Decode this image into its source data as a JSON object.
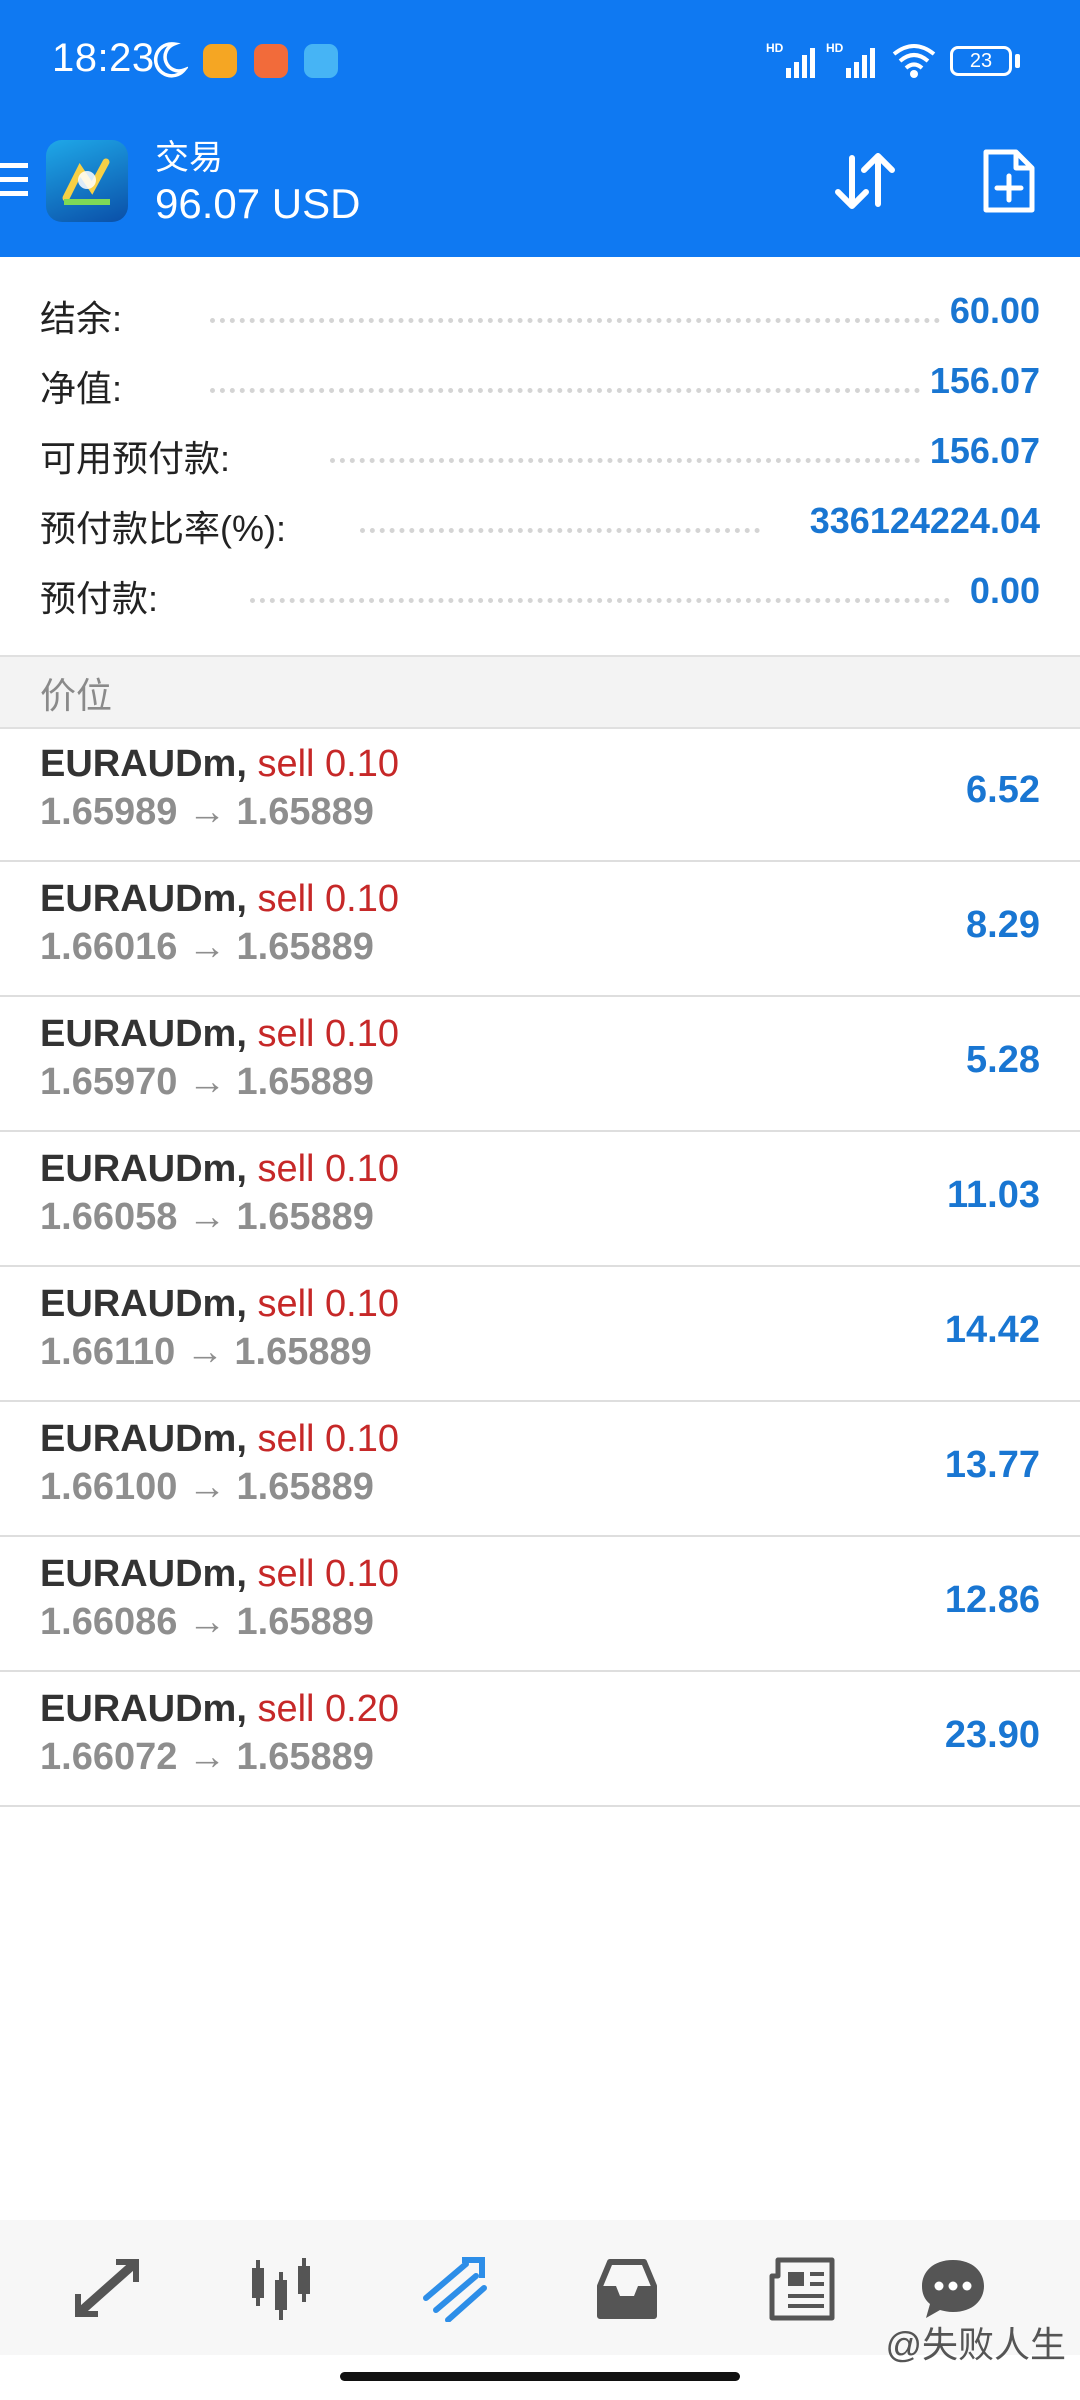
{
  "status_bar": {
    "time": "18:23",
    "battery": "23"
  },
  "header": {
    "title": "交易",
    "balance": "96.07 USD",
    "accent_color": "#0f79f2"
  },
  "summary": [
    {
      "label": "结余:",
      "value": "60.00"
    },
    {
      "label": "净值:",
      "value": "156.07"
    },
    {
      "label": "可用预付款:",
      "value": "156.07"
    },
    {
      "label": "预付款比率(%):",
      "value": "336124224.04"
    },
    {
      "label": "预付款:",
      "value": "0.00"
    }
  ],
  "section": {
    "title": "价位"
  },
  "positions": [
    {
      "symbol": "EURAUDm,",
      "side": "sell 0.10",
      "open": "1.65989",
      "arrow": "→",
      "current": "1.65889",
      "profit": "6.52"
    },
    {
      "symbol": "EURAUDm,",
      "side": "sell 0.10",
      "open": "1.66016",
      "arrow": "→",
      "current": "1.65889",
      "profit": "8.29"
    },
    {
      "symbol": "EURAUDm,",
      "side": "sell 0.10",
      "open": "1.65970",
      "arrow": "→",
      "current": "1.65889",
      "profit": "5.28"
    },
    {
      "symbol": "EURAUDm,",
      "side": "sell 0.10",
      "open": "1.66058",
      "arrow": "→",
      "current": "1.65889",
      "profit": "11.03"
    },
    {
      "symbol": "EURAUDm,",
      "side": "sell 0.10",
      "open": "1.66110",
      "arrow": "→",
      "current": "1.65889",
      "profit": "14.42"
    },
    {
      "symbol": "EURAUDm,",
      "side": "sell 0.10",
      "open": "1.66100",
      "arrow": "→",
      "current": "1.65889",
      "profit": "13.77"
    },
    {
      "symbol": "EURAUDm,",
      "side": "sell 0.10",
      "open": "1.66086",
      "arrow": "→",
      "current": "1.65889",
      "profit": "12.86"
    },
    {
      "symbol": "EURAUDm,",
      "side": "sell 0.20",
      "open": "1.66072",
      "arrow": "→",
      "current": "1.65889",
      "profit": "23.90"
    }
  ],
  "bottom_nav": [
    {
      "icon": "quotes-icon"
    },
    {
      "icon": "chart-icon"
    },
    {
      "icon": "trade-icon",
      "active": true
    },
    {
      "icon": "history-icon"
    },
    {
      "icon": "news-icon"
    },
    {
      "icon": "messages-icon"
    }
  ],
  "watermark": "@失败人生"
}
